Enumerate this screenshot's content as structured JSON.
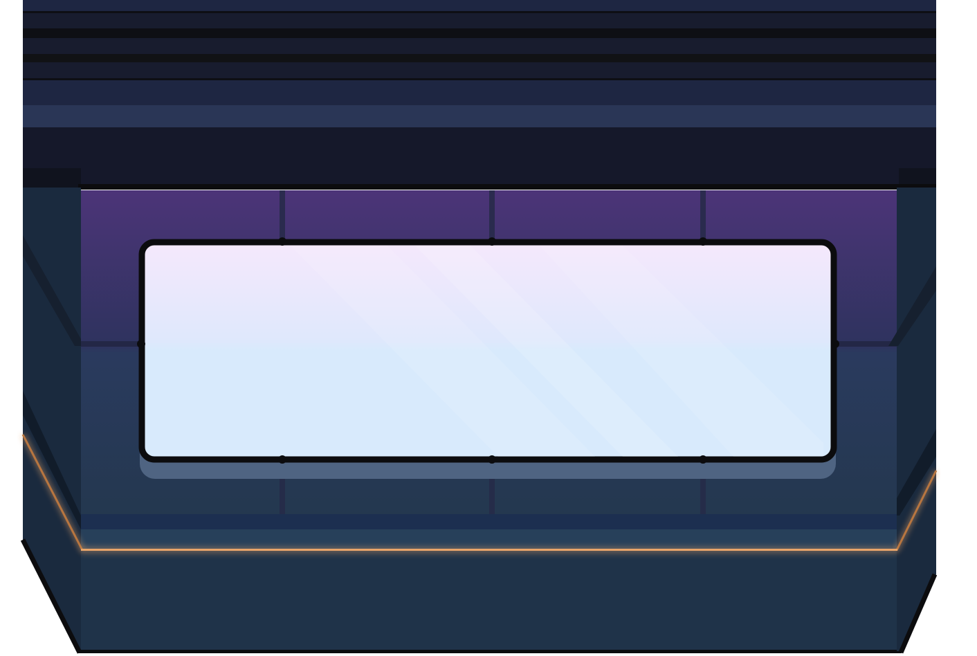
{
  "scene": {
    "type": "spaceship room background",
    "parts": [
      "ceiling-panels",
      "back-wall",
      "window",
      "left-wall",
      "right-wall",
      "floor",
      "floor-light-strip"
    ]
  },
  "colors": {
    "background": "#ffffff",
    "ceiling_band_light": "#1e2642",
    "ceiling_band_dark": "#181c2e",
    "ceiling_stripe": "#0e0f14",
    "ceiling_highlight": "#2a3656",
    "ceiling_shadow": "#15182a",
    "wall_purple": "#4c3478",
    "wall_navy": "#2a3a5e",
    "wall_bottom": "#24384f",
    "side_wall": "#1a2a3e",
    "floor": "#1f3349",
    "floor_lip": "#1c2f50",
    "window_top": "#f5e8fc",
    "window_bottom": "#d8eafc",
    "window_shadow": "#4f6482",
    "outline": "#0c0c0e",
    "light_strip": "#e8a56a"
  }
}
